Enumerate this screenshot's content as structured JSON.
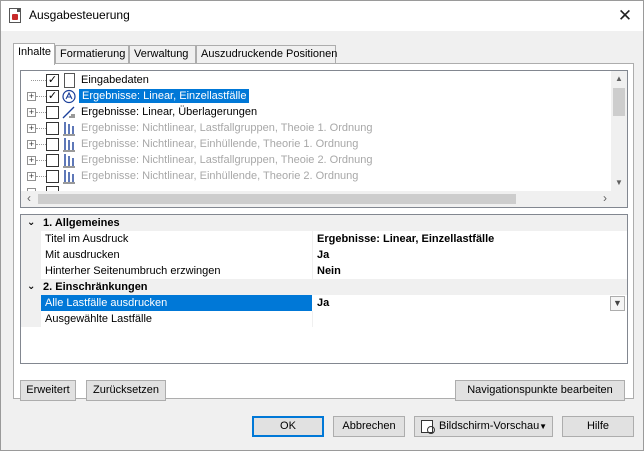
{
  "window": {
    "title": "Ausgabesteuerung",
    "close_glyph": "✕"
  },
  "tabs": [
    {
      "label": "Inhalte",
      "active": true
    },
    {
      "label": "Formatierung",
      "active": false
    },
    {
      "label": "Verwaltung",
      "active": false
    },
    {
      "label": "Auszudruckende Positionen",
      "active": false
    }
  ],
  "tree": {
    "items": [
      {
        "label": "Eingabedaten",
        "checked": true,
        "icon": "document-icon",
        "state": "normal"
      },
      {
        "label": "Ergebnisse: Linear, Einzellastfälle",
        "checked": true,
        "icon": "load-case-icon",
        "state": "selected"
      },
      {
        "label": "Ergebnisse: Linear, Überlagerungen",
        "checked": false,
        "icon": "line-results-icon",
        "state": "normal"
      },
      {
        "label": "Ergebnisse: Nichtlinear, Lastfallgruppen, Theoie 1. Ordnung",
        "checked": false,
        "icon": "nonlinear-icon",
        "state": "disabled"
      },
      {
        "label": "Ergebnisse: Nichtlinear, Einhüllende, Theorie 1. Ordnung",
        "checked": false,
        "icon": "nonlinear-icon",
        "state": "disabled"
      },
      {
        "label": "Ergebnisse: Nichtlinear, Lastfallgruppen, Theoie 2. Ordnung",
        "checked": false,
        "icon": "nonlinear-icon",
        "state": "disabled"
      },
      {
        "label": "Ergebnisse: Nichtlinear, Einhüllende, Theorie 2. Ordnung",
        "checked": false,
        "icon": "nonlinear-icon",
        "state": "disabled"
      }
    ],
    "expander_glyph": "+",
    "check_glyph": "✓"
  },
  "properties": {
    "sections": [
      {
        "label": "1. Allgemeines",
        "rows": [
          {
            "name": "Titel im Ausdruck",
            "value": "Ergebnisse: Linear, Einzellastfälle"
          },
          {
            "name": "Mit ausdrucken",
            "value": "Ja"
          },
          {
            "name": "Hinterher Seitenumbruch erzwingen",
            "value": "Nein"
          }
        ]
      },
      {
        "label": "2. Einschränkungen",
        "rows": [
          {
            "name": "Alle Lastfälle ausdrucken",
            "value": "Ja",
            "selected": true
          },
          {
            "name": "Ausgewählte Lastfälle",
            "value": ""
          }
        ]
      }
    ],
    "collapse_glyph": "⌄"
  },
  "buttons": {
    "erweitert": "Erweitert",
    "zuruecksetzen": "Zurücksetzen",
    "navigationspunkte": "Navigationspunkte bearbeiten",
    "ok": "OK",
    "abbrechen": "Abbrechen",
    "vorschau": "Bildschirm-Vorschau",
    "hilfe": "Hilfe"
  }
}
